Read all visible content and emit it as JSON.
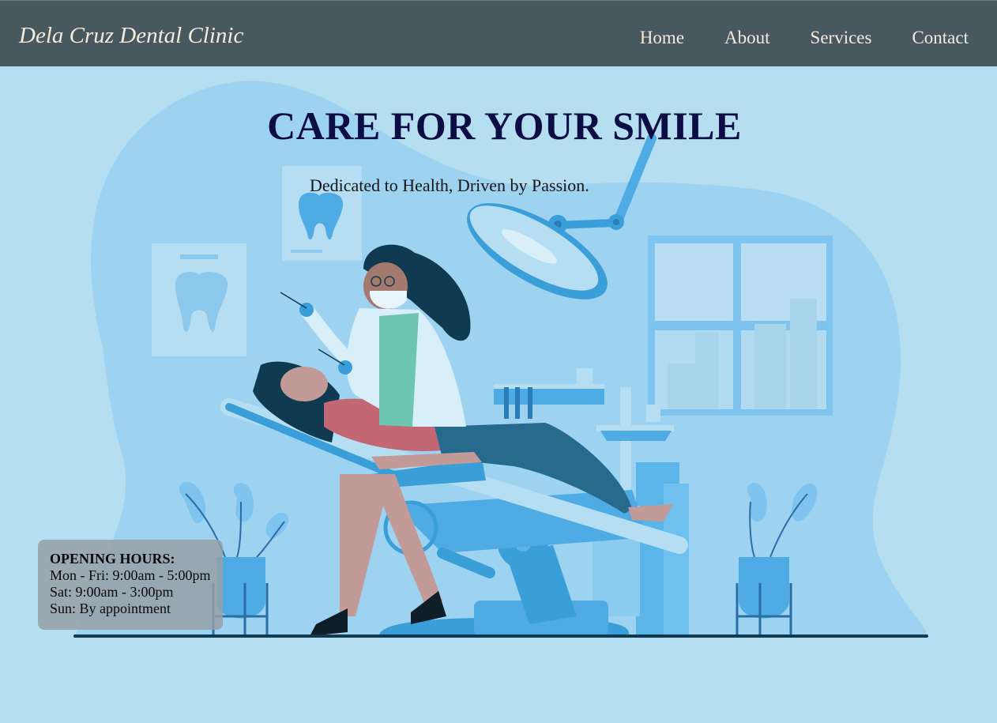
{
  "brand": "Dela Cruz Dental Clinic",
  "nav": {
    "home": "Home",
    "about": "About",
    "services": "Services",
    "contact": "Contact"
  },
  "hero": {
    "headline": "CARE FOR YOUR SMILE",
    "tagline": "Dedicated to Health, Driven by Passion."
  },
  "hours": {
    "title": "OPENING HOURS:",
    "weekdays": "Mon - Fri: 9:00am - 5:00pm",
    "saturday": "Sat: 9:00am - 3:00pm",
    "sunday": "Sun: By appointment"
  },
  "colors": {
    "navbar": "#48585f",
    "background": "#b5dff0",
    "headline": "#0d0d45",
    "nav_text": "#f3ecdd"
  },
  "icons": [
    "dental-clinic-illustration",
    "tooth-poster-icon",
    "dental-chair",
    "dental-lamp",
    "plant-pot-icon",
    "window"
  ]
}
